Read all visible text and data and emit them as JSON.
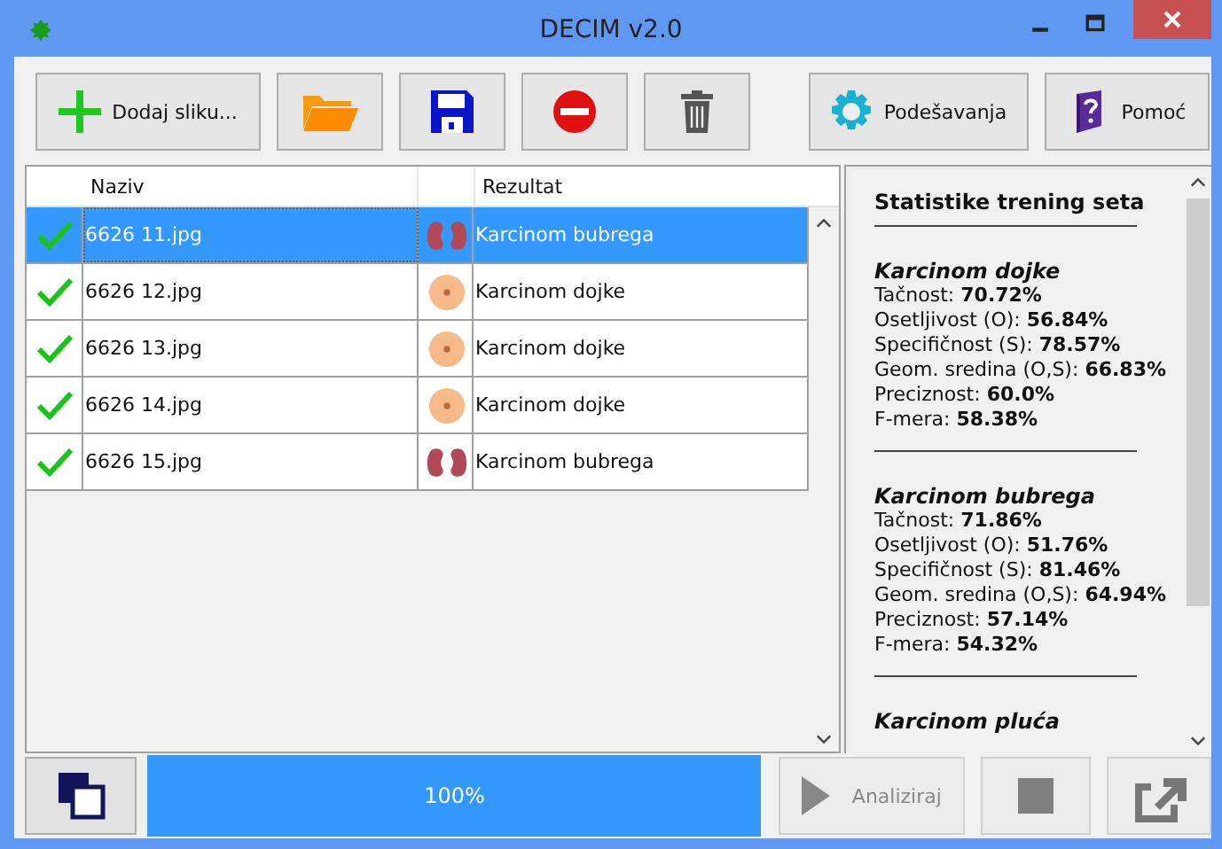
{
  "window": {
    "title": "DECIM v2.0"
  },
  "toolbar": [
    {
      "kind": "add",
      "label": "Dodaj sliku..."
    },
    {
      "kind": "open"
    },
    {
      "kind": "save"
    },
    {
      "kind": "remove"
    },
    {
      "kind": "delete"
    },
    {
      "kind": "settings",
      "label": "Podešavanja"
    },
    {
      "kind": "help",
      "label": "Pomoć"
    }
  ],
  "table": {
    "columns": [
      "Naziv",
      "Rezultat"
    ],
    "rows": [
      {
        "checked": true,
        "name": "6626 11.jpg",
        "kind": "kidney",
        "result": "Karcinom bubrega",
        "selected": true
      },
      {
        "checked": true,
        "name": "6626 12.jpg",
        "kind": "breast",
        "result": "Karcinom dojke",
        "selected": false
      },
      {
        "checked": true,
        "name": "6626 13.jpg",
        "kind": "breast",
        "result": "Karcinom dojke",
        "selected": false
      },
      {
        "checked": true,
        "name": "6626 14.jpg",
        "kind": "breast",
        "result": "Karcinom dojke",
        "selected": false
      },
      {
        "checked": true,
        "name": "6626 15.jpg",
        "kind": "kidney",
        "result": "Karcinom bubrega",
        "selected": false
      }
    ]
  },
  "stats": {
    "title": "Statistike trening seta",
    "sections": [
      {
        "title": "Karcinom dojke",
        "lines": [
          {
            "label": "Tačnost:",
            "value": "70.72%"
          },
          {
            "label": "Osetljivost (O):",
            "value": "56.84%"
          },
          {
            "label": "Specifičnost (S):",
            "value": "78.57%"
          },
          {
            "label": "Geom. sredina (O,S):",
            "value": "66.83%"
          },
          {
            "label": "Preciznost:",
            "value": "60.0%"
          },
          {
            "label": "F-mera:",
            "value": "58.38%"
          }
        ]
      },
      {
        "title": "Karcinom bubrega",
        "lines": [
          {
            "label": "Tačnost:",
            "value": "71.86%"
          },
          {
            "label": "Osetljivost (O):",
            "value": "51.76%"
          },
          {
            "label": "Specifičnost (S):",
            "value": "81.46%"
          },
          {
            "label": "Geom. sredina (O,S):",
            "value": "64.94%"
          },
          {
            "label": "Preciznost:",
            "value": "57.14%"
          },
          {
            "label": "F-mera:",
            "value": "54.32%"
          }
        ]
      },
      {
        "title": "Karcinom pluća"
      }
    ]
  },
  "bottom": {
    "progress": {
      "level": 1.0,
      "text": "100%"
    },
    "buttons": [
      {
        "kind": "analyze",
        "label": "Analiziraj",
        "disabled": true
      },
      {
        "kind": "stop",
        "disabled": true
      },
      {
        "kind": "export",
        "disabled": true
      }
    ]
  }
}
